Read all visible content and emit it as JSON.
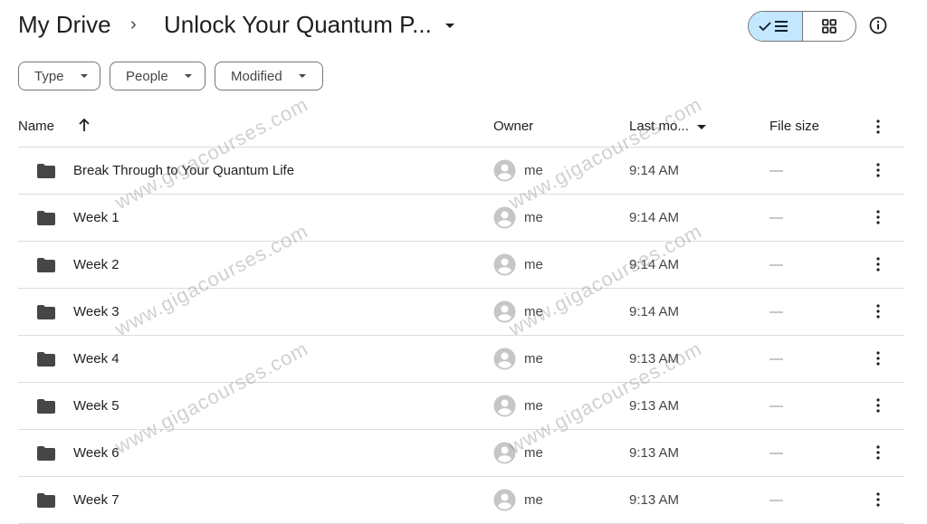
{
  "breadcrumb": {
    "root": "My Drive",
    "separator_icon": "chevron-right-icon",
    "current": "Unlock Your Quantum P...",
    "current_dropdown_icon": "caret-down-icon"
  },
  "view_toggle": {
    "list_view": {
      "icon": "check-list-icon",
      "active": true
    },
    "grid_view": {
      "icon": "grid-icon",
      "active": false
    }
  },
  "info_button": {
    "icon": "info-icon"
  },
  "filters": [
    {
      "label": "Type"
    },
    {
      "label": "People"
    },
    {
      "label": "Modified"
    }
  ],
  "table": {
    "columns": {
      "name": "Name",
      "name_sort_icon": "arrow-up-icon",
      "owner": "Owner",
      "last_modified": "Last mo...",
      "file_size": "File size"
    },
    "rows": [
      {
        "name": "Break Through to Your Quantum Life",
        "owner": "me",
        "modified": "9:14 AM",
        "size": "—"
      },
      {
        "name": "Week 1",
        "owner": "me",
        "modified": "9:14 AM",
        "size": "—"
      },
      {
        "name": "Week 2",
        "owner": "me",
        "modified": "9:14 AM",
        "size": "—"
      },
      {
        "name": "Week 3",
        "owner": "me",
        "modified": "9:14 AM",
        "size": "—"
      },
      {
        "name": "Week 4",
        "owner": "me",
        "modified": "9:13 AM",
        "size": "—"
      },
      {
        "name": "Week 5",
        "owner": "me",
        "modified": "9:13 AM",
        "size": "—"
      },
      {
        "name": "Week 6",
        "owner": "me",
        "modified": "9:13 AM",
        "size": "—"
      },
      {
        "name": "Week 7",
        "owner": "me",
        "modified": "9:13 AM",
        "size": "—"
      }
    ]
  },
  "watermark": "www.gigacourses.com",
  "colors": {
    "active_toggle_bg": "#c2e7ff",
    "folder": "#444746",
    "avatar": "#c4c7c5",
    "divider": "#dadce0"
  }
}
